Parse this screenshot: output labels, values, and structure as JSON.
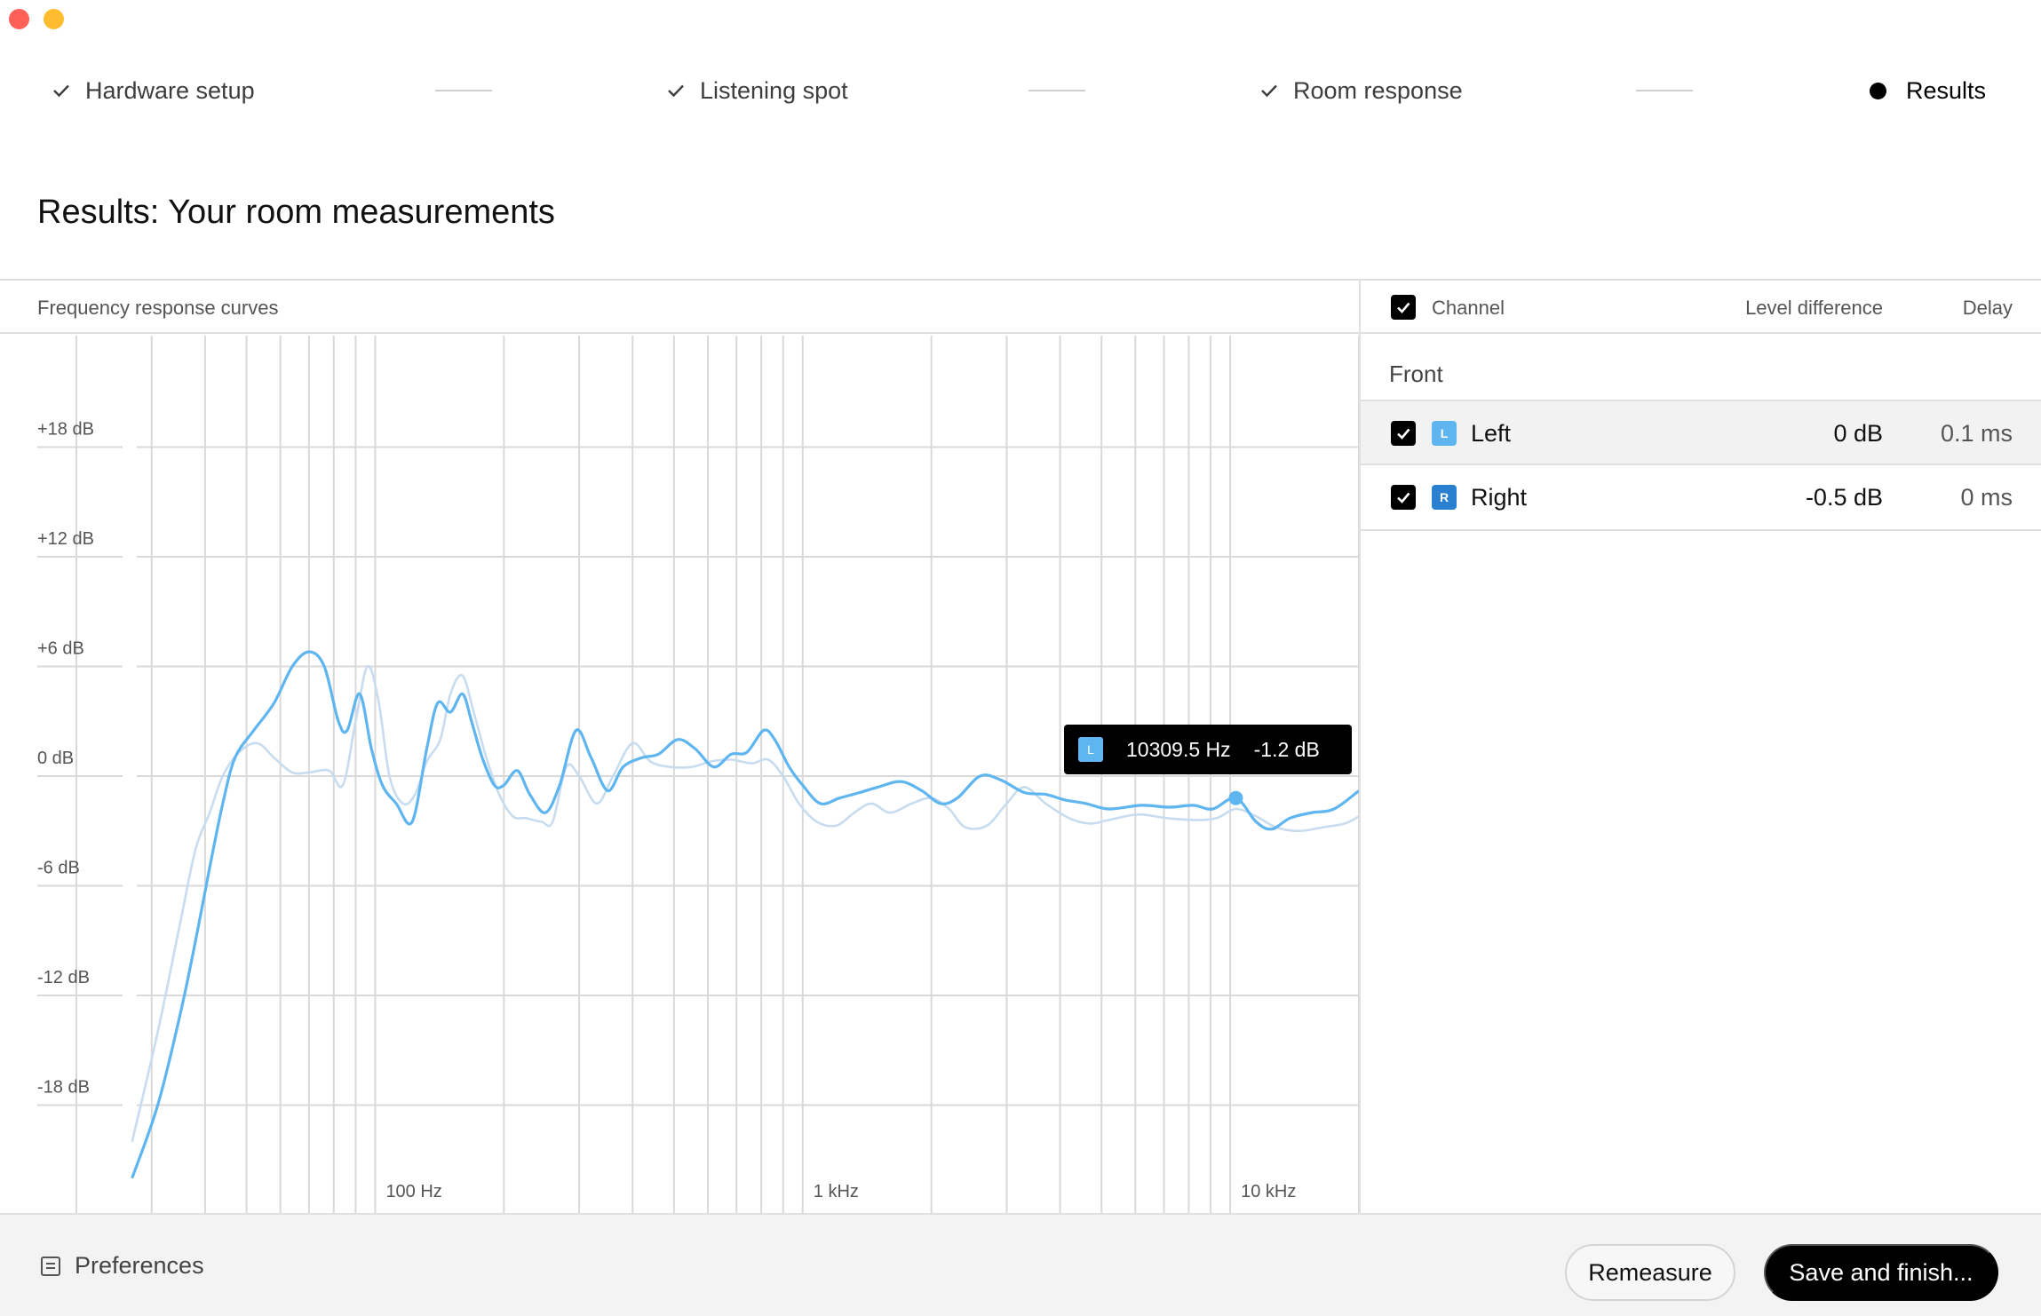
{
  "window": {
    "controls": [
      "close",
      "minimize"
    ]
  },
  "stepper": {
    "steps": [
      {
        "label": "Hardware setup",
        "state": "done",
        "icon": "check-icon"
      },
      {
        "label": "Listening spot",
        "state": "done",
        "icon": "check-icon"
      },
      {
        "label": "Room response",
        "state": "done",
        "icon": "check-icon"
      },
      {
        "label": "Results",
        "state": "current",
        "icon": "bullet-icon"
      }
    ]
  },
  "page": {
    "title": "Results: Your room measurements"
  },
  "chart_panel": {
    "title": "Frequency response curves"
  },
  "chart_data": {
    "type": "line",
    "x_scale": "log",
    "xlim": [
      20,
      20000
    ],
    "ylim": [
      -22,
      22
    ],
    "grid": true,
    "x_tick_labels": [
      {
        "value": 100,
        "label": "100 Hz"
      },
      {
        "value": 1000,
        "label": "1 kHz"
      },
      {
        "value": 10000,
        "label": "10 kHz"
      }
    ],
    "y_tick_labels": [
      {
        "value": 18,
        "label": "+18 dB"
      },
      {
        "value": 12,
        "label": "+12 dB"
      },
      {
        "value": 6,
        "label": "+6 dB"
      },
      {
        "value": 0,
        "label": "0 dB"
      },
      {
        "value": -6,
        "label": "-6 dB"
      },
      {
        "value": -12,
        "label": "-12 dB"
      },
      {
        "value": -18,
        "label": "-18 dB"
      }
    ],
    "series": [
      {
        "name": "Left",
        "color": "#5eb5f0",
        "points": [
          [
            27,
            -22
          ],
          [
            31,
            -18
          ],
          [
            35,
            -13
          ],
          [
            38,
            -9
          ],
          [
            41,
            -5
          ],
          [
            44,
            -1.5
          ],
          [
            47,
            1
          ],
          [
            52,
            2.5
          ],
          [
            58,
            4
          ],
          [
            64,
            6
          ],
          [
            70,
            6.8
          ],
          [
            76,
            6
          ],
          [
            82,
            3
          ],
          [
            86,
            2.5
          ],
          [
            92,
            4.5
          ],
          [
            98,
            1.5
          ],
          [
            104,
            -0.5
          ],
          [
            112,
            -1.5
          ],
          [
            122,
            -2.5
          ],
          [
            132,
            1.5
          ],
          [
            140,
            4
          ],
          [
            150,
            3.5
          ],
          [
            160,
            4.5
          ],
          [
            168,
            3
          ],
          [
            178,
            1
          ],
          [
            190,
            -0.5
          ],
          [
            200,
            -0.5
          ],
          [
            215,
            0.3
          ],
          [
            230,
            -1
          ],
          [
            250,
            -2
          ],
          [
            270,
            -0.5
          ],
          [
            295,
            2.5
          ],
          [
            320,
            1
          ],
          [
            350,
            -0.8
          ],
          [
            380,
            0.5
          ],
          [
            420,
            1
          ],
          [
            460,
            1.2
          ],
          [
            510,
            2
          ],
          [
            560,
            1.5
          ],
          [
            620,
            0.5
          ],
          [
            680,
            1.2
          ],
          [
            740,
            1.3
          ],
          [
            810,
            2.5
          ],
          [
            860,
            2
          ],
          [
            930,
            0.5
          ],
          [
            1000,
            -0.5
          ],
          [
            1100,
            -1.5
          ],
          [
            1220,
            -1.2
          ],
          [
            1360,
            -0.9
          ],
          [
            1500,
            -0.6
          ],
          [
            1700,
            -0.3
          ],
          [
            1900,
            -0.8
          ],
          [
            2100,
            -1.5
          ],
          [
            2300,
            -1.2
          ],
          [
            2600,
            0
          ],
          [
            2900,
            -0.2
          ],
          [
            3300,
            -0.9
          ],
          [
            3700,
            -1
          ],
          [
            4100,
            -1.3
          ],
          [
            4600,
            -1.5
          ],
          [
            5200,
            -1.8
          ],
          [
            6200,
            -1.6
          ],
          [
            7200,
            -1.7
          ],
          [
            8200,
            -1.6
          ],
          [
            9100,
            -1.8
          ],
          [
            10309.5,
            -1.2
          ],
          [
            11500,
            -2.5
          ],
          [
            12500,
            -2.9
          ],
          [
            13800,
            -2.3
          ],
          [
            15500,
            -2
          ],
          [
            17500,
            -1.8
          ],
          [
            20000,
            -0.8
          ]
        ]
      },
      {
        "name": "Right",
        "color": "#c8dcef",
        "points": [
          [
            27,
            -20
          ],
          [
            31,
            -14
          ],
          [
            35,
            -8
          ],
          [
            38,
            -4
          ],
          [
            41,
            -2
          ],
          [
            44,
            0
          ],
          [
            48,
            1.3
          ],
          [
            53,
            1.8
          ],
          [
            58,
            1
          ],
          [
            64,
            0.2
          ],
          [
            70,
            0.2
          ],
          [
            78,
            0.3
          ],
          [
            84,
            -0.5
          ],
          [
            90,
            3
          ],
          [
            96,
            6
          ],
          [
            102,
            4
          ],
          [
            108,
            0
          ],
          [
            116,
            -1.5
          ],
          [
            124,
            -1
          ],
          [
            132,
            0.8
          ],
          [
            142,
            2
          ],
          [
            150,
            4.5
          ],
          [
            160,
            5.5
          ],
          [
            170,
            3.5
          ],
          [
            182,
            1
          ],
          [
            195,
            -1
          ],
          [
            210,
            -2.2
          ],
          [
            225,
            -2.3
          ],
          [
            245,
            -2.5
          ],
          [
            260,
            -2.5
          ],
          [
            280,
            0.5
          ],
          [
            300,
            0
          ],
          [
            330,
            -1.5
          ],
          [
            360,
            0
          ],
          [
            400,
            1.8
          ],
          [
            440,
            0.8
          ],
          [
            490,
            0.5
          ],
          [
            550,
            0.5
          ],
          [
            610,
            0.8
          ],
          [
            680,
            0.9
          ],
          [
            760,
            0.7
          ],
          [
            830,
            0.9
          ],
          [
            900,
            0
          ],
          [
            980,
            -1.5
          ],
          [
            1080,
            -2.5
          ],
          [
            1200,
            -2.7
          ],
          [
            1320,
            -2
          ],
          [
            1450,
            -1.5
          ],
          [
            1600,
            -2
          ],
          [
            1800,
            -1.5
          ],
          [
            2000,
            -1.2
          ],
          [
            2200,
            -1.8
          ],
          [
            2400,
            -2.8
          ],
          [
            2700,
            -2.7
          ],
          [
            3000,
            -1.5
          ],
          [
            3300,
            -0.6
          ],
          [
            3700,
            -1.5
          ],
          [
            4200,
            -2.3
          ],
          [
            4700,
            -2.6
          ],
          [
            5200,
            -2.4
          ],
          [
            6100,
            -2.1
          ],
          [
            7100,
            -2.3
          ],
          [
            8300,
            -2.4
          ],
          [
            9300,
            -2.3
          ],
          [
            10300,
            -1.8
          ],
          [
            11500,
            -2.2
          ],
          [
            12800,
            -2.8
          ],
          [
            14500,
            -3
          ],
          [
            16500,
            -2.8
          ],
          [
            18500,
            -2.6
          ],
          [
            20000,
            -2.2
          ]
        ]
      }
    ],
    "hover": {
      "series": "L",
      "frequency": "10309.5 Hz",
      "level": "-1.2 dB",
      "x": 10309.5,
      "y": -1.2
    }
  },
  "channels_table": {
    "columns": {
      "channel": "Channel",
      "level": "Level difference",
      "delay": "Delay"
    },
    "groups": [
      {
        "label": "Front",
        "rows": [
          {
            "badge": "L",
            "name": "Left",
            "level": "0 dB",
            "delay": "0.1 ms",
            "badge_color": "#5eb5f0",
            "checked": true
          },
          {
            "badge": "R",
            "name": "Right",
            "level": "-0.5 dB",
            "delay": "0 ms",
            "badge_color": "#2a7fce",
            "checked": true
          }
        ]
      }
    ]
  },
  "footer": {
    "preferences_label": "Preferences",
    "remeasure_label": "Remeasure",
    "save_label": "Save and finish..."
  }
}
